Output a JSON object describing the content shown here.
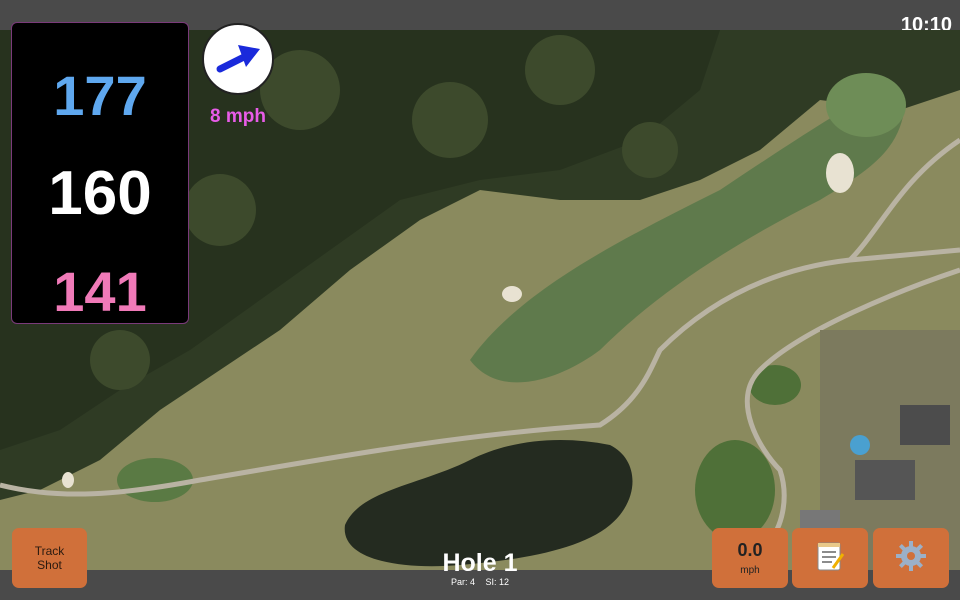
{
  "status": {
    "time": "10:10"
  },
  "distances": {
    "back": "177",
    "middle": "160",
    "front": "141"
  },
  "wind": {
    "speed": "8 mph",
    "icon": "wind-arrow-icon"
  },
  "buttons": {
    "track_shot": "Track Shot",
    "speed_value": "0.0",
    "speed_unit": "mph",
    "notes_icon": "notepad-icon",
    "settings_icon": "gear-icon"
  },
  "hole": {
    "title": "Hole 1",
    "par": "Par: 4",
    "si": "SI: 12"
  },
  "colors": {
    "back": "#5fa8ef",
    "middle": "#ffffff",
    "front": "#f07ab8",
    "wind_text": "#e85ce8",
    "button": "#d0703a",
    "bar": "#4a4a4a"
  }
}
